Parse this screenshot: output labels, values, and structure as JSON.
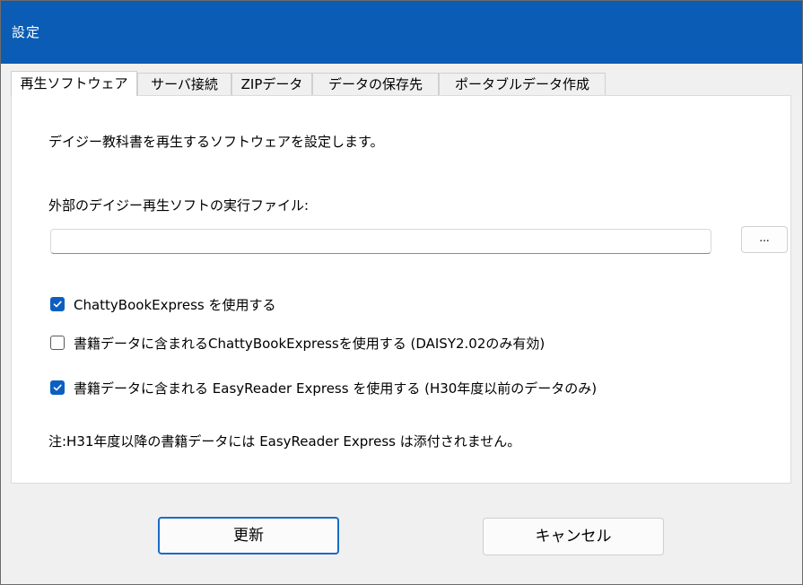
{
  "window": {
    "title": "設定"
  },
  "tabs": [
    {
      "label": "再生ソフトウェア",
      "active": true
    },
    {
      "label": "サーバ接続",
      "active": false
    },
    {
      "label": "ZIPデータ",
      "active": false
    },
    {
      "label": "データの保存先",
      "active": false
    },
    {
      "label": "ポータブルデータ作成",
      "active": false
    }
  ],
  "panel": {
    "description": "デイジー教科書を再生するソフトウェアを設定します。",
    "external_label": "外部のデイジー再生ソフトの実行ファイル:",
    "external_path_value": "",
    "browse_label": "...",
    "options": [
      {
        "label": "ChattyBookExpress を使用する",
        "checked": true
      },
      {
        "label": "書籍データに含まれるChattyBookExpressを使用する (DAISY2.02のみ有効)",
        "checked": false
      },
      {
        "label": "書籍データに含まれる EasyReader Express を使用する (H30年度以前のデータのみ)",
        "checked": true
      }
    ],
    "note": "注:H31年度以降の書籍データには EasyReader Express は添付されません。"
  },
  "buttons": {
    "update_label": "更新",
    "cancel_label": "キャンセル"
  },
  "colors": {
    "titlebar": "#0b5cb4",
    "accent": "#0c5fc0"
  }
}
